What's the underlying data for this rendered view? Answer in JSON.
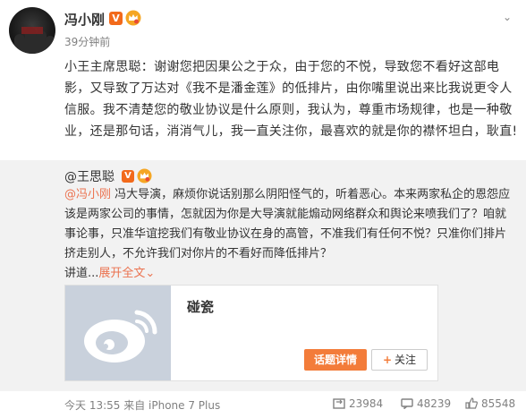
{
  "post": {
    "author": "冯小刚",
    "time": "39分钟前",
    "verified_badge": "V",
    "text": "小王主席思聪：谢谢您把因果公之于众，由于您的不悦，导致您不看好这部电影，又导致了万达对《我不是潘金莲》的低排片，由你嘴里说出来比我说更令人信服。我不清楚您的敬业协议是什么原则，我认为，尊重市场规律，也是一种敬业，还是那句话，消消气儿，我一直关注你，最喜欢的就是你的襟怀坦白，耿直!"
  },
  "repost": {
    "author": "@王思聪",
    "verified_badge": "V",
    "mention": "@冯小刚",
    "text": " 冯大导演，麻烦你说话别那么阴阳怪气的，听着恶心。本来两家私企的恩怨应该是两家公司的事情，怎就因为你是大导演就能煽动网络群众和舆论来喷我们了？咱就事论事，只准华谊挖我们有敬业协议在身的高管，不准我们有任何不悦？只准你们排片挤走别人，不允许我们对你片的不看好而降低排片？",
    "tail": "讲道...",
    "expand": "展开全文",
    "expand_arrow": "⌄",
    "card": {
      "title": "碰瓷",
      "topic_button": "话题详情",
      "follow_button": "关注",
      "follow_plus": "+"
    },
    "source": "今天 13:55 来自 iPhone 7 Plus",
    "reposts": "23984",
    "comments": "48239",
    "likes": "85548"
  },
  "colors": {
    "accent": "#eb7350",
    "badge": "#f26a1b",
    "topic_button": "#f37c3a",
    "repost_bg": "#f2f2f2"
  },
  "icons": [
    "avatar",
    "verified-icon",
    "crown-icon",
    "chevron-down-icon",
    "weibo-logo-icon",
    "repost-icon",
    "comment-icon",
    "like-icon"
  ]
}
